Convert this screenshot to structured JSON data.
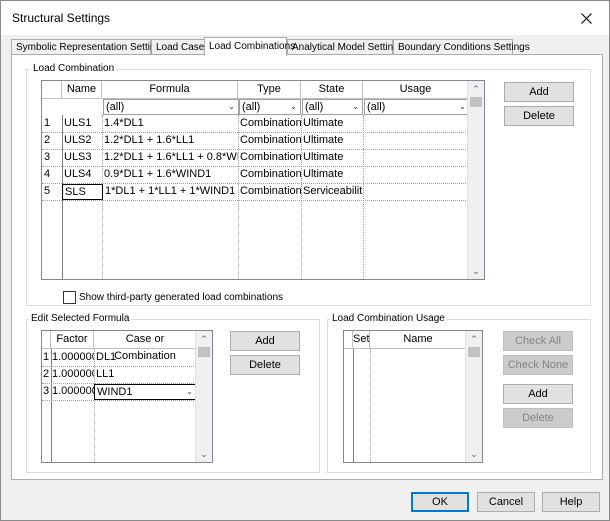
{
  "window": {
    "title": "Structural Settings"
  },
  "tabs": [
    "Symbolic Representation Settings",
    "Load Cases",
    "Load Combinations",
    "Analytical Model Settings",
    "Boundary Conditions Settings"
  ],
  "load_combination": {
    "group_label": "Load Combination",
    "columns": [
      "Name",
      "Formula",
      "Type",
      "State",
      "Usage"
    ],
    "filters": [
      "(all)",
      "(all)",
      "(all)",
      "(all)"
    ],
    "rows": [
      {
        "num": "1",
        "name": "ULS1",
        "formula": "1.4*DL1",
        "type": "Combination",
        "state": "Ultimate",
        "usage": ""
      },
      {
        "num": "2",
        "name": "ULS2",
        "formula": "1.2*DL1 + 1.6*LL1",
        "type": "Combination",
        "state": "Ultimate",
        "usage": ""
      },
      {
        "num": "3",
        "name": "ULS3",
        "formula": "1.2*DL1 + 1.6*LL1 + 0.8*WIN",
        "type": "Combination",
        "state": "Ultimate",
        "usage": ""
      },
      {
        "num": "4",
        "name": "ULS4",
        "formula": "0.9*DL1 + 1.6*WIND1",
        "type": "Combination",
        "state": "Ultimate",
        "usage": ""
      },
      {
        "num": "5",
        "name": "SLS",
        "formula": "1*DL1 + 1*LL1 + 1*WIND1",
        "type": "Combination",
        "state": "Serviceabilit",
        "usage": ""
      }
    ],
    "add_label": "Add",
    "delete_label": "Delete",
    "show_third_party_label": "Show third-party generated load combinations",
    "show_third_party_checked": false
  },
  "edit_formula": {
    "group_label": "Edit Selected Formula",
    "columns": [
      "Factor",
      "Case or Combination"
    ],
    "rows": [
      {
        "num": "1",
        "factor": "1.000000",
        "case": "DL1"
      },
      {
        "num": "2",
        "factor": "1.000000",
        "case": "LL1"
      },
      {
        "num": "3",
        "factor": "1.000000",
        "case": "WIND1"
      }
    ],
    "add_label": "Add",
    "delete_label": "Delete"
  },
  "usage": {
    "group_label": "Load Combination Usage",
    "columns": [
      "Set",
      "Name"
    ],
    "check_all_label": "Check All",
    "check_none_label": "Check None",
    "add_label": "Add",
    "delete_label": "Delete"
  },
  "footer": {
    "ok_label": "OK",
    "cancel_label": "Cancel",
    "help_label": "Help"
  }
}
